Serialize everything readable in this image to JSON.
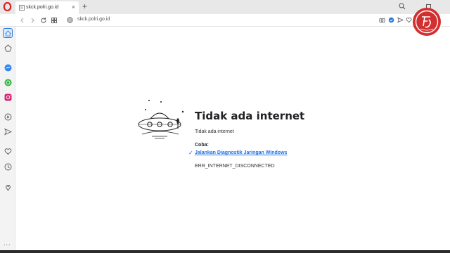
{
  "tab": {
    "title": "skck.polri.go.id",
    "close_glyph": "×"
  },
  "new_tab_glyph": "+",
  "address": {
    "url": "skck.polri.go.id"
  },
  "error": {
    "title": "Tidak ada internet",
    "subtitle": "Tidak ada internet",
    "try_label": "Coba:",
    "diagnostic_link": "Jalankan Diagnostik Jaringan Windows",
    "code": "ERR_INTERNET_DISCONNECTED"
  },
  "sidebar": {
    "more_glyph": "..."
  },
  "colors": {
    "opera_red": "#e0231e",
    "link_blue": "#1a73e8",
    "messenger_blue": "#2f86f6",
    "whatsapp_green": "#2fb344",
    "instagram_pink": "#d62976"
  }
}
